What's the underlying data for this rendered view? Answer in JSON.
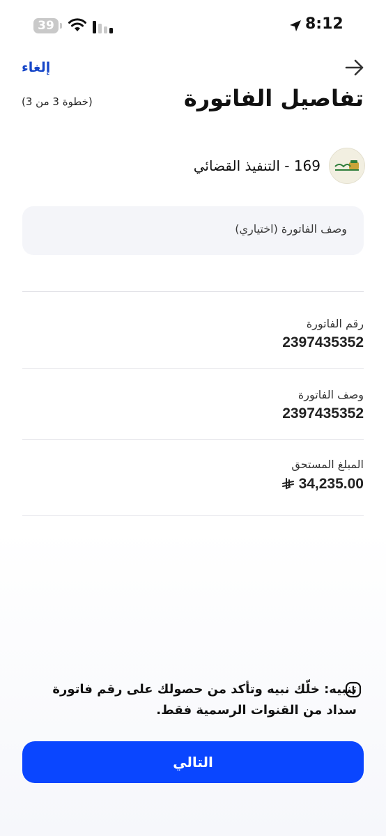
{
  "status_bar": {
    "battery": "39",
    "time": "8:12",
    "icons": [
      "battery-icon",
      "wifi-icon",
      "cellular-signal-icon",
      "location-arrow-icon"
    ]
  },
  "header": {
    "back_icon": "arrow-right-icon",
    "cancel_label": "إلغاء",
    "title": "تفاصيل الفاتورة",
    "step": "(خطوة 3 من 3)"
  },
  "biller": {
    "name": "169 - التنفيذ القضائي",
    "logo_icon": "judicial-enforcement-logo"
  },
  "description_input": {
    "placeholder": "وصف الفاتورة (اختياري)",
    "value": ""
  },
  "details": [
    {
      "label": "رقم الفاتورة",
      "value": "2397435352"
    },
    {
      "label": "وصف الفاتورة",
      "value": "2397435352"
    },
    {
      "label": "المبلغ المستحق",
      "value": "34,235.00",
      "currency_icon": "saudi-riyal-icon"
    }
  ],
  "warning": {
    "icon": "alert-icon",
    "text": "تنبيه: خلّك نبيه وتأكد من حصولك على رقم فاتورة سداد من القنوات الرسمية فقط."
  },
  "next_button": {
    "label": "التالي"
  },
  "colors": {
    "accent": "#0a46ff",
    "link": "#1646c8",
    "input_bg": "#f4f5f9"
  }
}
